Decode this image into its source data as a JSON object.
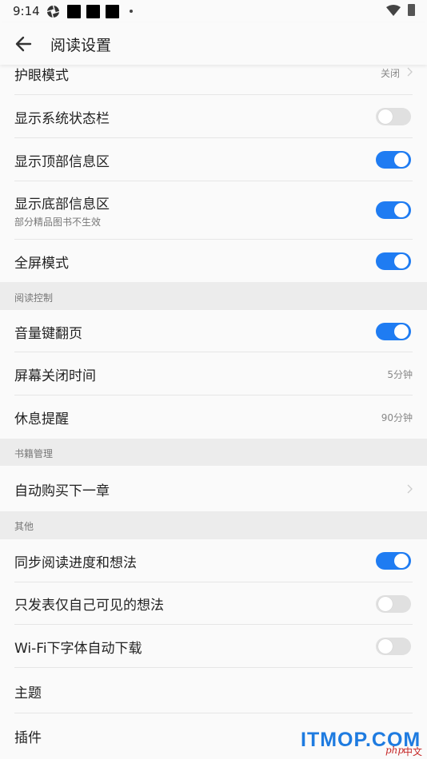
{
  "status_bar": {
    "time": "9:14"
  },
  "header": {
    "title": "阅读设置"
  },
  "rows": {
    "eye_mode": {
      "label": "护眼模式",
      "value": "关闭"
    },
    "show_status_bar": {
      "label": "显示系统状态栏",
      "toggle": false
    },
    "show_top_info": {
      "label": "显示顶部信息区",
      "toggle": true
    },
    "show_bottom_info": {
      "label": "显示底部信息区",
      "sub": "部分精品图书不生效",
      "toggle": true
    },
    "fullscreen": {
      "label": "全屏模式",
      "toggle": true
    },
    "volume_key": {
      "label": "音量键翻页",
      "toggle": true
    },
    "screen_off": {
      "label": "屏幕关闭时间",
      "value": "5分钟"
    },
    "rest_reminder": {
      "label": "休息提醒",
      "value": "90分钟"
    },
    "auto_buy": {
      "label": "自动购买下一章"
    },
    "sync_progress": {
      "label": "同步阅读进度和想法",
      "toggle": true
    },
    "private_thoughts": {
      "label": "只发表仅自己可见的想法",
      "toggle": false
    },
    "wifi_font": {
      "label": "Wi-Fi下字体自动下载",
      "toggle": false
    },
    "theme": {
      "label": "主题"
    },
    "plugins": {
      "label": "插件"
    }
  },
  "sections": {
    "reading_control": "阅读控制",
    "book_management": "书籍管理",
    "other": "其他"
  },
  "watermark": {
    "text": "ITMOP.COM",
    "php": "php",
    "cn": "中文网"
  },
  "colors": {
    "accent": "#1f7cf2",
    "toggle_off": "#e0e0e0",
    "section_bg": "#ececec"
  }
}
